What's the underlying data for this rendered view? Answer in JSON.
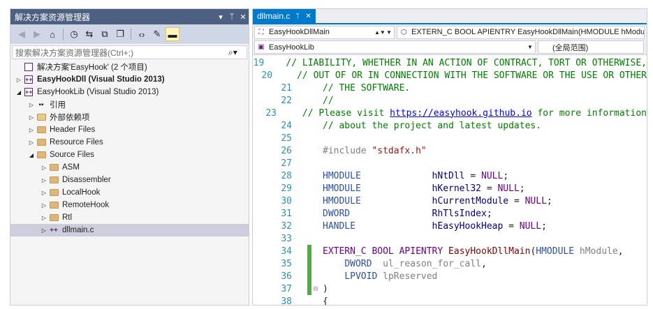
{
  "solution_explorer": {
    "title": "解决方案资源管理器",
    "controls": [
      "▾",
      "ᛘ",
      "✕"
    ],
    "search_placeholder": "搜索解决方案资源管理器(Ctrl+;)",
    "tree": [
      {
        "label": "解决方案'EasyHook' (2 个项目)",
        "indent": 0,
        "arrow": "",
        "icon": "solution",
        "bold": false
      },
      {
        "label": "EasyHookDll (Visual Studio 2013)",
        "indent": 0,
        "arrow": "▷",
        "icon": "project",
        "bold": true
      },
      {
        "label": "EasyHookLib (Visual Studio 2013)",
        "indent": 0,
        "arrow": "◢",
        "icon": "project",
        "bold": false
      },
      {
        "label": "引用",
        "indent": 1,
        "arrow": "▷",
        "icon": "references",
        "bold": false
      },
      {
        "label": "外部依赖项",
        "indent": 1,
        "arrow": "▷",
        "icon": "external",
        "bold": false
      },
      {
        "label": "Header Files",
        "indent": 1,
        "arrow": "▷",
        "icon": "folder",
        "bold": false
      },
      {
        "label": "Resource Files",
        "indent": 1,
        "arrow": "▷",
        "icon": "folder",
        "bold": false
      },
      {
        "label": "Source Files",
        "indent": 1,
        "arrow": "◢",
        "icon": "folder",
        "bold": false
      },
      {
        "label": "ASM",
        "indent": 2,
        "arrow": "▷",
        "icon": "folder",
        "bold": false
      },
      {
        "label": "Disassembler",
        "indent": 2,
        "arrow": "▷",
        "icon": "folder",
        "bold": false
      },
      {
        "label": "LocalHook",
        "indent": 2,
        "arrow": "▷",
        "icon": "folder",
        "bold": false
      },
      {
        "label": "RemoteHook",
        "indent": 2,
        "arrow": "▷",
        "icon": "folder",
        "bold": false
      },
      {
        "label": "Rtl",
        "indent": 2,
        "arrow": "▷",
        "icon": "folder",
        "bold": false
      },
      {
        "label": "dllmain.c",
        "indent": 2,
        "arrow": "▷",
        "icon": "cfile",
        "bold": false,
        "selected": true
      }
    ]
  },
  "editor": {
    "tab": {
      "label": "dllmain.c",
      "pin": "ᛘ",
      "close": "✕"
    },
    "nav": {
      "scope": "EasyHookDllMain",
      "member": "EXTERN_C BOOL APIENTRY EasyHookDllMain(HMODULE hModule, DWORD",
      "project": "EasyHookLib",
      "global": "(全局范围)"
    },
    "lines": [
      {
        "n": "19",
        "mark": "",
        "fold": "",
        "html": "<span class='c-com'>// LIABILITY, WHETHER IN AN ACTION OF CONTRACT, TORT OR OTHERWISE,</span>"
      },
      {
        "n": "20",
        "mark": "",
        "fold": "",
        "html": "<span class='c-com'>// OUT OF OR IN CONNECTION WITH THE SOFTWARE OR THE USE OR OTHER</span>"
      },
      {
        "n": "21",
        "mark": "",
        "fold": "",
        "html": "<span class='c-com'>// THE SOFTWARE.</span>"
      },
      {
        "n": "22",
        "mark": "",
        "fold": "",
        "html": "<span class='c-com'>//</span>"
      },
      {
        "n": "23",
        "mark": "",
        "fold": "",
        "html": "<span class='c-com'>// Please visit </span><span class='c-link'>https://easyhook.github.io</span><span class='c-com'> for more information</span>"
      },
      {
        "n": "24",
        "mark": "",
        "fold": "",
        "html": "<span class='c-com'>// about the project and latest updates.</span>"
      },
      {
        "n": "25",
        "mark": "",
        "fold": "",
        "html": ""
      },
      {
        "n": "26",
        "mark": "",
        "fold": "",
        "html": "<span class='c-pre'>#include </span><span class='c-str'>\"stdafx.h\"</span>"
      },
      {
        "n": "27",
        "mark": "",
        "fold": "",
        "html": ""
      },
      {
        "n": "28",
        "mark": "",
        "fold": "",
        "html": "<span class='c-type'>HMODULE</span>             <span class='c-var'>hNtDll</span> = <span class='c-mac'>NULL</span>;"
      },
      {
        "n": "29",
        "mark": "",
        "fold": "",
        "html": "<span class='c-type'>HMODULE</span>             <span class='c-var'>hKernel32</span> = <span class='c-mac'>NULL</span>;"
      },
      {
        "n": "30",
        "mark": "",
        "fold": "",
        "html": "<span class='c-type'>HMODULE</span>             <span class='c-var'>hCurrentModule</span> = <span class='c-mac'>NULL</span>;"
      },
      {
        "n": "31",
        "mark": "",
        "fold": "",
        "html": "<span class='c-type'>DWORD</span>               <span class='c-var'>RhTlsIndex</span>;"
      },
      {
        "n": "32",
        "mark": "",
        "fold": "",
        "html": "<span class='c-type'>HANDLE</span>              <span class='c-var'>hEasyHookHeap</span> = <span class='c-mac'>NULL</span>;"
      },
      {
        "n": "33",
        "mark": "",
        "fold": "",
        "html": ""
      },
      {
        "n": "34",
        "mark": "changed",
        "fold": "",
        "html": "<span class='c-mac'>EXTERN_C</span> <span class='c-mac'>BOOL</span> <span class='c-mac'>APIENTRY</span> <span class='c-fn'>EasyHookDllMain</span>(<span class='c-type'>HMODULE</span> <span class='c-par'>hModule</span>,"
      },
      {
        "n": "35",
        "mark": "changed",
        "fold": "",
        "html": "    <span class='c-type'>DWORD</span>  <span class='c-par'>ul_reason_for_call</span>,"
      },
      {
        "n": "36",
        "mark": "changed",
        "fold": "",
        "html": "    <span class='c-type'>LPVOID</span> <span class='c-par'>lpReserved</span>"
      },
      {
        "n": "37",
        "mark": "changed",
        "fold": "⊟",
        "html": ")"
      },
      {
        "n": "38",
        "mark": "",
        "fold": "",
        "html": "{"
      }
    ]
  }
}
